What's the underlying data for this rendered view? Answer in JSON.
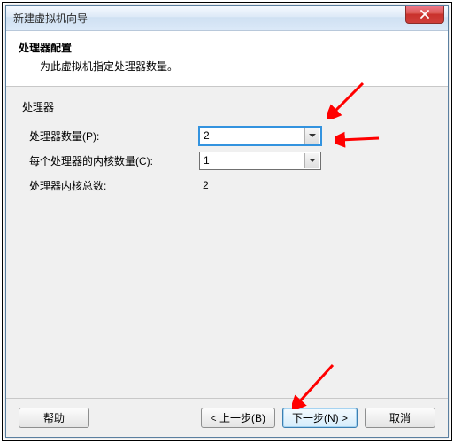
{
  "window": {
    "title": "新建虚拟机向导",
    "close_label": "X"
  },
  "header": {
    "title": "处理器配置",
    "subtitle": "为此虚拟机指定处理器数量。"
  },
  "body": {
    "section_label": "处理器",
    "row1_label": "处理器数量(P):",
    "row1_value": "2",
    "row2_label": "每个处理器的内核数量(C):",
    "row2_value": "1",
    "row3_label": "处理器内核总数:",
    "row3_value": "2"
  },
  "footer": {
    "help": "帮助",
    "back": "< 上一步(B)",
    "next": "下一步(N) >",
    "cancel": "取消"
  },
  "colors": {
    "accent": "#3393df",
    "arrow": "#ff0000"
  }
}
